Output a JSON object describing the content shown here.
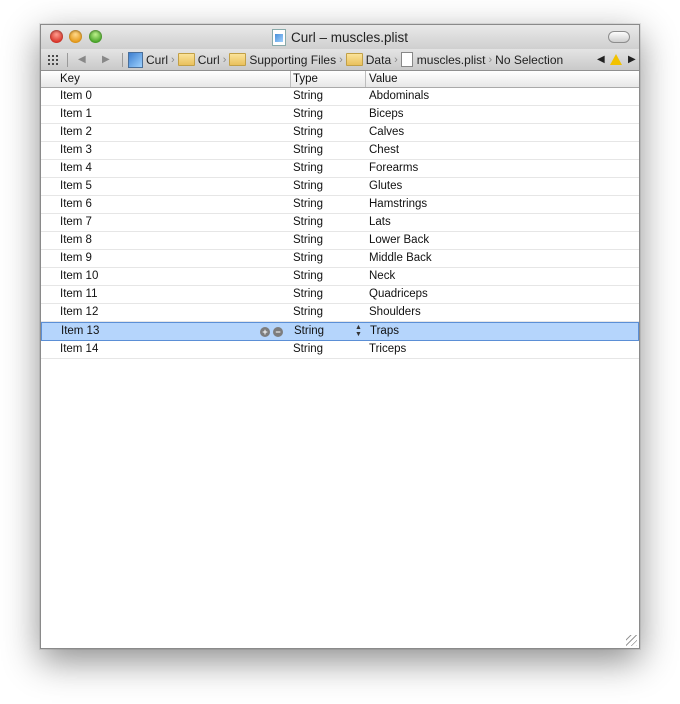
{
  "window": {
    "title": "Curl – muscles.plist"
  },
  "jumpbar": {
    "crumbs": [
      {
        "label": "Curl",
        "icon": "project-icon"
      },
      {
        "label": "Curl",
        "icon": "folder-icon"
      },
      {
        "label": "Supporting Files",
        "icon": "folder-icon"
      },
      {
        "label": "Data",
        "icon": "folder-icon"
      },
      {
        "label": "muscles.plist",
        "icon": "file-icon"
      },
      {
        "label": "No Selection",
        "icon": ""
      }
    ]
  },
  "table": {
    "headers": {
      "key": "Key",
      "type": "Type",
      "value": "Value"
    },
    "rows": [
      {
        "key": "Item 0",
        "type": "String",
        "value": "Abdominals"
      },
      {
        "key": "Item 1",
        "type": "String",
        "value": "Biceps"
      },
      {
        "key": "Item 2",
        "type": "String",
        "value": "Calves"
      },
      {
        "key": "Item 3",
        "type": "String",
        "value": "Chest"
      },
      {
        "key": "Item 4",
        "type": "String",
        "value": "Forearms"
      },
      {
        "key": "Item 5",
        "type": "String",
        "value": "Glutes"
      },
      {
        "key": "Item 6",
        "type": "String",
        "value": "Hamstrings"
      },
      {
        "key": "Item 7",
        "type": "String",
        "value": "Lats"
      },
      {
        "key": "Item 8",
        "type": "String",
        "value": "Lower Back"
      },
      {
        "key": "Item 9",
        "type": "String",
        "value": "Middle Back"
      },
      {
        "key": "Item 10",
        "type": "String",
        "value": "Neck"
      },
      {
        "key": "Item 11",
        "type": "String",
        "value": "Quadriceps"
      },
      {
        "key": "Item 12",
        "type": "String",
        "value": "Shoulders"
      },
      {
        "key": "Item 13",
        "type": "String",
        "value": "Traps",
        "selected": true
      },
      {
        "key": "Item 14",
        "type": "String",
        "value": "Triceps"
      }
    ]
  },
  "colors": {
    "selection": "#b5d5fc",
    "selection_border": "#5b8fd6",
    "warning": "#f2c200"
  }
}
